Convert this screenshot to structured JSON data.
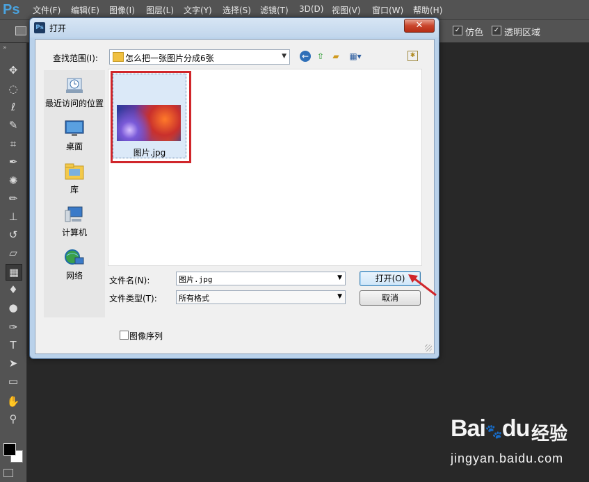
{
  "app": {
    "logo": "Ps",
    "menus": [
      "文件(F)",
      "编辑(E)",
      "图像(I)",
      "图层(L)",
      "文字(Y)",
      "选择(S)",
      "滤镜(T)",
      "3D(D)",
      "视图(V)",
      "窗口(W)",
      "帮助(H)"
    ]
  },
  "options_bar": {
    "dither_label": "仿色",
    "transparency_label": "透明区域"
  },
  "tools": [
    "move",
    "marquee",
    "lasso",
    "quick-select",
    "crop",
    "eyedropper",
    "healing",
    "brush",
    "stamp",
    "history-brush",
    "eraser",
    "gradient",
    "blur",
    "dodge",
    "pen",
    "type",
    "path-select",
    "shape",
    "hand",
    "zoom"
  ],
  "dialog": {
    "icon": "Ps",
    "title": "打开",
    "close": "✕",
    "look_in_label": "查找范围(I):",
    "look_in_value": "怎么把一张图片分成6张",
    "places": [
      "最近访问的位置",
      "桌面",
      "库",
      "计算机",
      "网络"
    ],
    "files": [
      {
        "name": "图片.jpg"
      }
    ],
    "filename_label": "文件名(N):",
    "filename_value": "图片.jpg",
    "filetype_label": "文件类型(T):",
    "filetype_value": "所有格式",
    "open_button": "打开(O)",
    "cancel_button": "取消",
    "image_sequence_label": "图像序列"
  },
  "watermark": {
    "brand": "Bai",
    "brand_suffix": "du",
    "cn": "经验",
    "url": "jingyan.baidu.com"
  },
  "colors": {
    "annotation": "#d0262b",
    "ps_blue": "#4aa3df"
  }
}
